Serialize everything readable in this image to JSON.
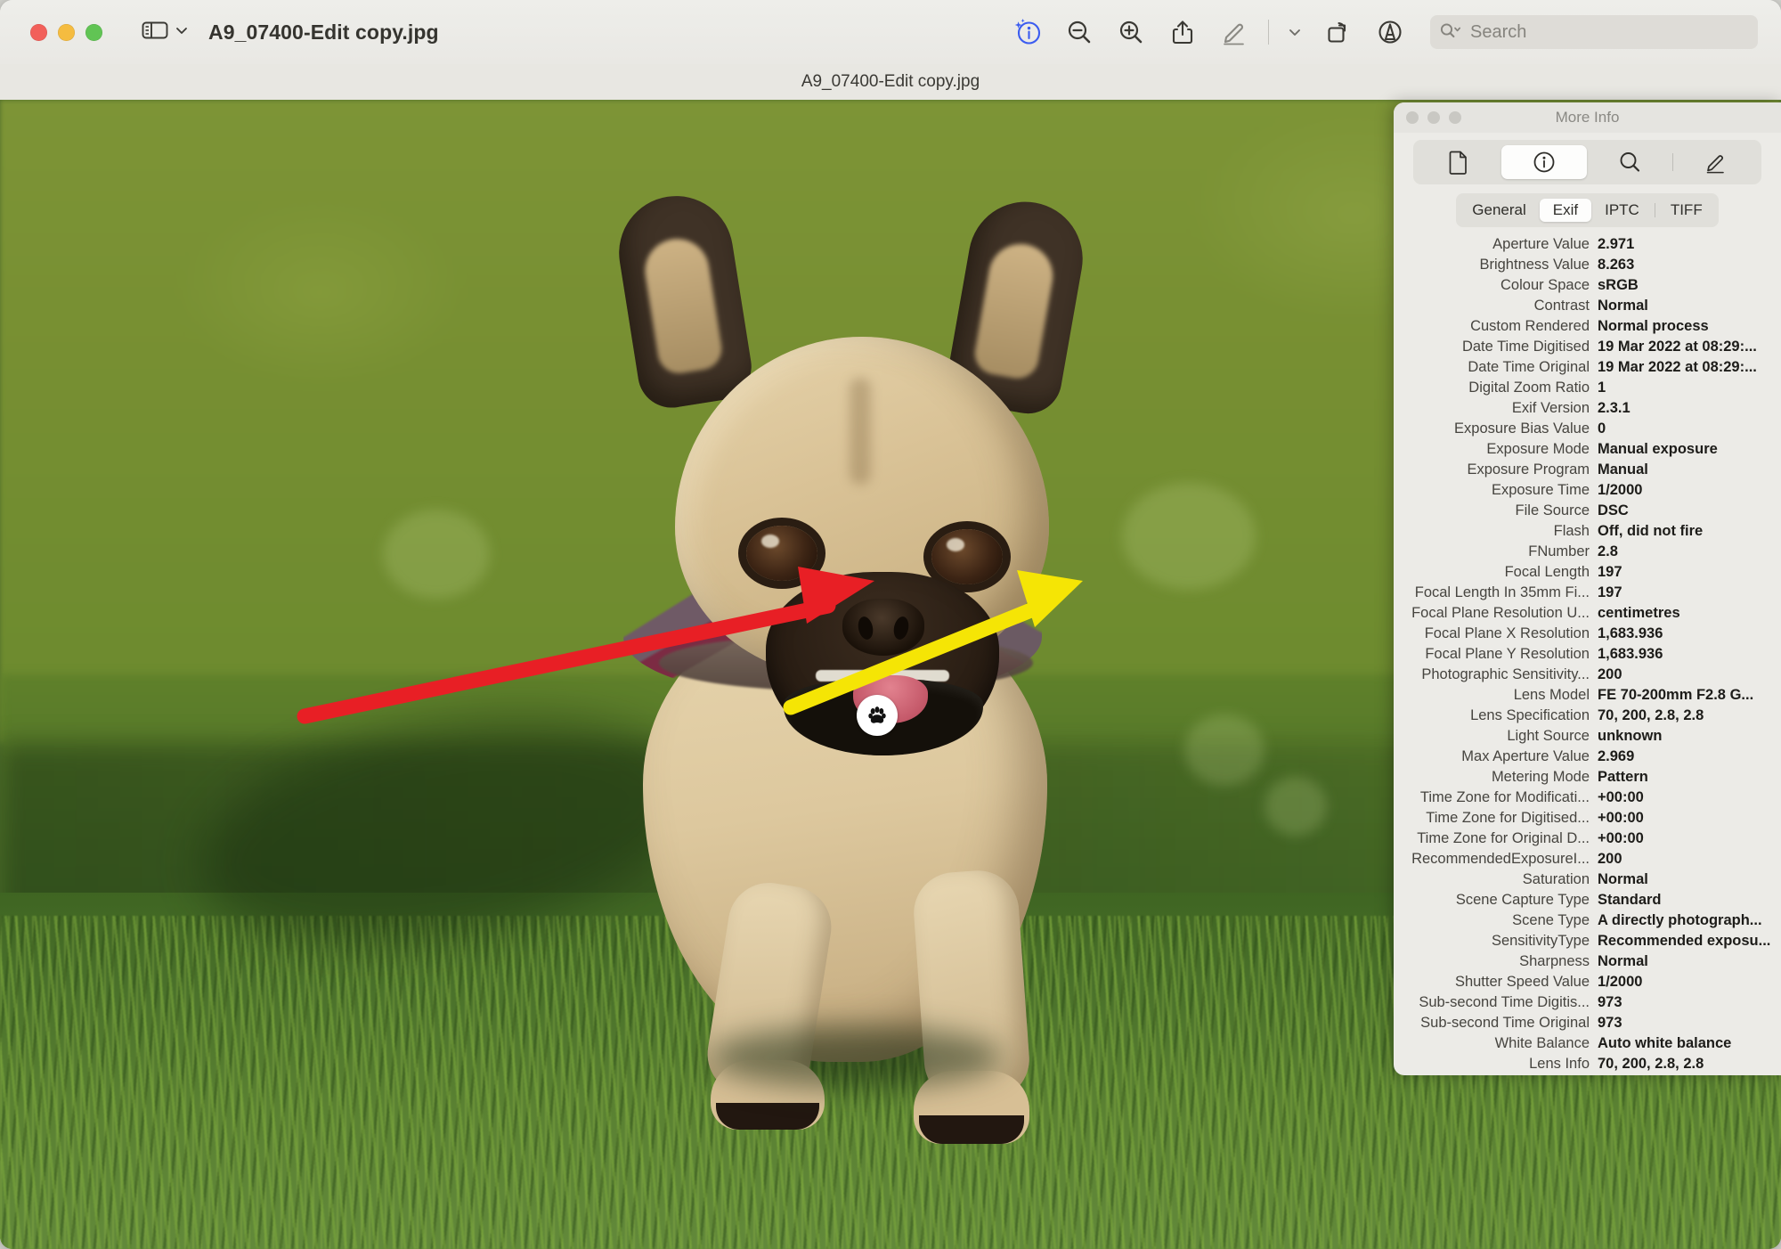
{
  "window": {
    "title": "A9_07400-Edit copy.jpg",
    "subtitle": "A9_07400-Edit copy.jpg",
    "traffic_lights": [
      "close",
      "minimise",
      "zoom"
    ]
  },
  "toolbar": {
    "sidebar_toggle": "sidebar-toggle",
    "buttons": [
      {
        "name": "markup-info-button",
        "icon": "info-sparkle-icon",
        "label": "Info",
        "active": true
      },
      {
        "name": "zoom-out-button",
        "icon": "zoom-out-icon",
        "label": "Zoom Out",
        "active": false
      },
      {
        "name": "zoom-in-button",
        "icon": "zoom-in-icon",
        "label": "Zoom In",
        "active": false
      },
      {
        "name": "share-button",
        "icon": "share-icon",
        "label": "Share",
        "active": false
      },
      {
        "name": "markup-button",
        "icon": "pencil-icon",
        "label": "Markup",
        "active": false
      },
      {
        "name": "rotate-button",
        "icon": "rotate-icon",
        "label": "Rotate Left",
        "active": false
      },
      {
        "name": "annotate-button",
        "icon": "annotate-circle-icon",
        "label": "Annotate",
        "active": false
      }
    ],
    "accent_color": "#3b5cf0",
    "search": {
      "placeholder": "Search",
      "value": ""
    }
  },
  "annotations": {
    "red_arrow": {
      "color": "#e81f25",
      "points_to": "dog-mouth"
    },
    "yellow_arrow": {
      "color": "#f5e505",
      "points_to": "exif-panel"
    },
    "paw_badge": {
      "icon": "paw-print-icon",
      "background": "#ffffff",
      "foreground": "#000000"
    }
  },
  "info_panel": {
    "title": "More Info",
    "traffic_lights": [
      "close",
      "minimise",
      "zoom"
    ],
    "segments": [
      {
        "name": "document-segment",
        "icon": "document-icon",
        "active": false
      },
      {
        "name": "info-segment",
        "icon": "info-circle-icon",
        "active": true
      },
      {
        "name": "search-segment",
        "icon": "search-icon",
        "active": false
      },
      {
        "name": "markup-segment",
        "icon": "pencil-icon",
        "active": false
      }
    ],
    "tabs": [
      {
        "label": "General",
        "active": false
      },
      {
        "label": "Exif",
        "active": true
      },
      {
        "label": "IPTC",
        "active": false
      },
      {
        "label": "TIFF",
        "active": false
      }
    ],
    "exif": [
      {
        "key": "Aperture Value",
        "value": "2.971"
      },
      {
        "key": "Brightness Value",
        "value": "8.263"
      },
      {
        "key": "Colour Space",
        "value": "sRGB"
      },
      {
        "key": "Contrast",
        "value": "Normal"
      },
      {
        "key": "Custom Rendered",
        "value": "Normal process"
      },
      {
        "key": "Date Time Digitised",
        "value": "19 Mar 2022 at 08:29:..."
      },
      {
        "key": "Date Time Original",
        "value": "19 Mar 2022 at 08:29:..."
      },
      {
        "key": "Digital Zoom Ratio",
        "value": "1"
      },
      {
        "key": "Exif Version",
        "value": "2.3.1"
      },
      {
        "key": "Exposure Bias Value",
        "value": "0"
      },
      {
        "key": "Exposure Mode",
        "value": "Manual exposure"
      },
      {
        "key": "Exposure Program",
        "value": "Manual"
      },
      {
        "key": "Exposure Time",
        "value": "1/2000"
      },
      {
        "key": "File Source",
        "value": "DSC"
      },
      {
        "key": "Flash",
        "value": "Off, did not fire"
      },
      {
        "key": "FNumber",
        "value": "2.8"
      },
      {
        "key": "Focal Length",
        "value": "197"
      },
      {
        "key": "Focal Length In 35mm Fi...",
        "value": "197"
      },
      {
        "key": "Focal Plane Resolution U...",
        "value": "centimetres"
      },
      {
        "key": "Focal Plane X Resolution",
        "value": "1,683.936"
      },
      {
        "key": "Focal Plane Y Resolution",
        "value": "1,683.936"
      },
      {
        "key": "Photographic Sensitivity...",
        "value": "200"
      },
      {
        "key": "Lens Model",
        "value": "FE 70-200mm F2.8 G..."
      },
      {
        "key": "Lens Specification",
        "value": "70, 200, 2.8, 2.8"
      },
      {
        "key": "Light Source",
        "value": "unknown"
      },
      {
        "key": "Max Aperture Value",
        "value": "2.969"
      },
      {
        "key": "Metering Mode",
        "value": "Pattern"
      },
      {
        "key": "Time Zone for Modificati...",
        "value": "+00:00"
      },
      {
        "key": "Time Zone for Digitised...",
        "value": "+00:00"
      },
      {
        "key": "Time Zone for Original D...",
        "value": "+00:00"
      },
      {
        "key": "RecommendedExposureI...",
        "value": "200"
      },
      {
        "key": "Saturation",
        "value": "Normal"
      },
      {
        "key": "Scene Capture Type",
        "value": "Standard"
      },
      {
        "key": "Scene Type",
        "value": "A directly photograph..."
      },
      {
        "key": "SensitivityType",
        "value": "Recommended exposu..."
      },
      {
        "key": "Sharpness",
        "value": "Normal"
      },
      {
        "key": "Shutter Speed Value",
        "value": "1/2000"
      },
      {
        "key": "Sub-second Time Digitis...",
        "value": "973"
      },
      {
        "key": "Sub-second Time Original",
        "value": "973"
      },
      {
        "key": "White Balance",
        "value": "Auto white balance"
      },
      {
        "key": "Lens Info",
        "value": "70, 200, 2.8, 2.8"
      },
      {
        "key": "Lens Model",
        "value": "FE 70-200mm F2.8 G..."
      }
    ]
  }
}
